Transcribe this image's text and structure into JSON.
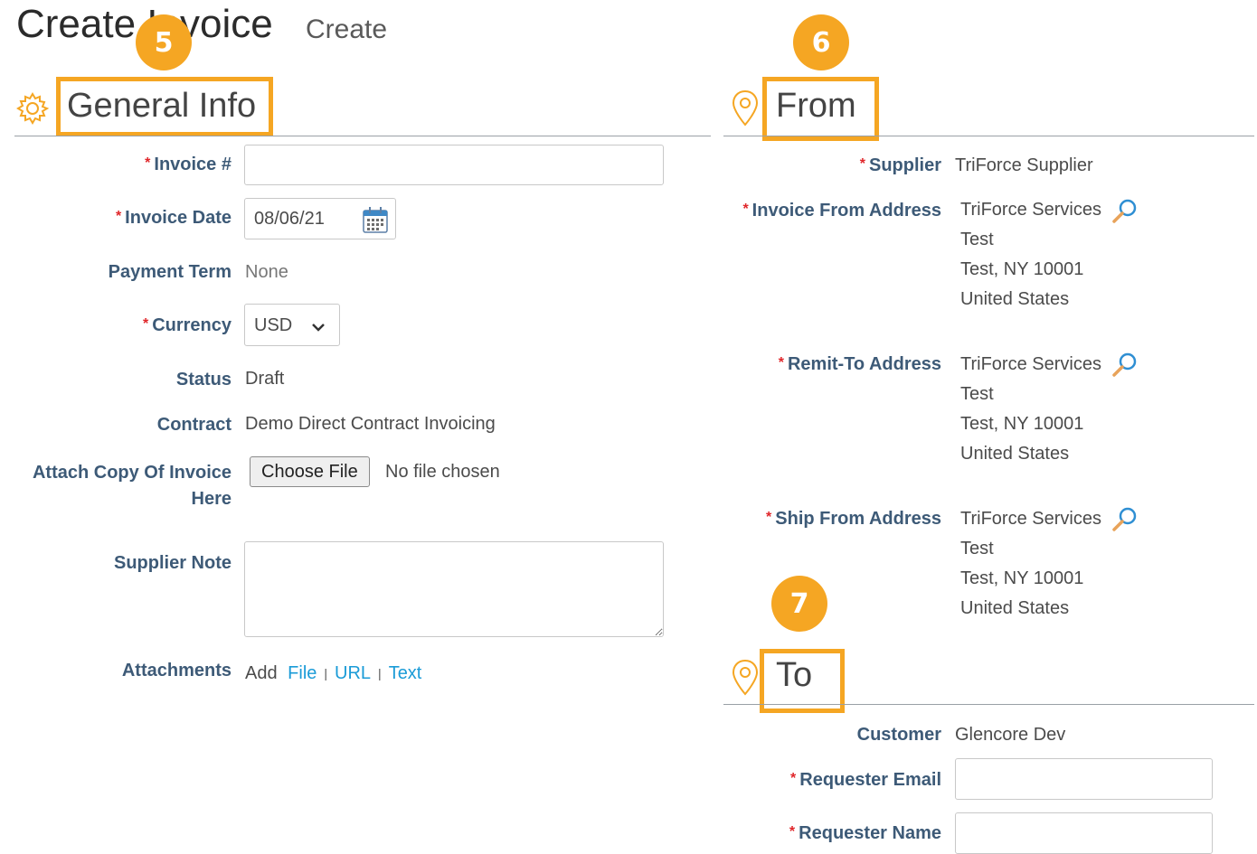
{
  "header": {
    "title": "Create Invoice",
    "subtitle": "Create"
  },
  "markers": {
    "general": "5",
    "from": "6",
    "to": "7"
  },
  "general_info": {
    "title": "General Info",
    "invoice_no_label": "Invoice #",
    "invoice_date_label": "Invoice Date",
    "invoice_date_value": "08/06/21",
    "payment_term_label": "Payment Term",
    "payment_term_value": "None",
    "currency_label": "Currency",
    "currency_value": "USD",
    "status_label": "Status",
    "status_value": "Draft",
    "contract_label": "Contract",
    "contract_value": "Demo Direct Contract Invoicing",
    "attach_label_1": "Attach Copy Of Invoice",
    "attach_label_2": "Here",
    "choose_file_label": "Choose File",
    "no_file_text": "No file chosen",
    "supplier_note_label": "Supplier Note",
    "attachments_label": "Attachments",
    "add_text": "Add",
    "file_link": "File",
    "url_link": "URL",
    "text_link": "Text"
  },
  "from": {
    "title": "From",
    "supplier_label": "Supplier",
    "supplier_value": "TriForce Supplier",
    "invoice_from_label": "Invoice From Address",
    "invoice_from": [
      "TriForce Services",
      "Test",
      "Test, NY 10001",
      "United States"
    ],
    "remit_to_label": "Remit-To Address",
    "remit_to": [
      "TriForce Services",
      "Test",
      "Test, NY 10001",
      "United States"
    ],
    "ship_from_label": "Ship From Address",
    "ship_from": [
      "TriForce Services",
      "Test",
      "Test, NY 10001",
      "United States"
    ]
  },
  "to": {
    "title": "To",
    "customer_label": "Customer",
    "customer_value": "Glencore Dev",
    "requester_email_label": "Requester Email",
    "requester_name_label": "Requester Name"
  },
  "required_mark": "*",
  "colors": {
    "accent": "#f5a623",
    "label": "#3d5a77",
    "link": "#1a9bd7",
    "required": "#e0262a"
  },
  "icons": {
    "general": "gear-icon",
    "from": "map-pin-icon",
    "to": "map-pin-icon",
    "lookup": "magnifier-icon",
    "calendar": "calendar-icon",
    "currency": "chevron-down-icon"
  }
}
